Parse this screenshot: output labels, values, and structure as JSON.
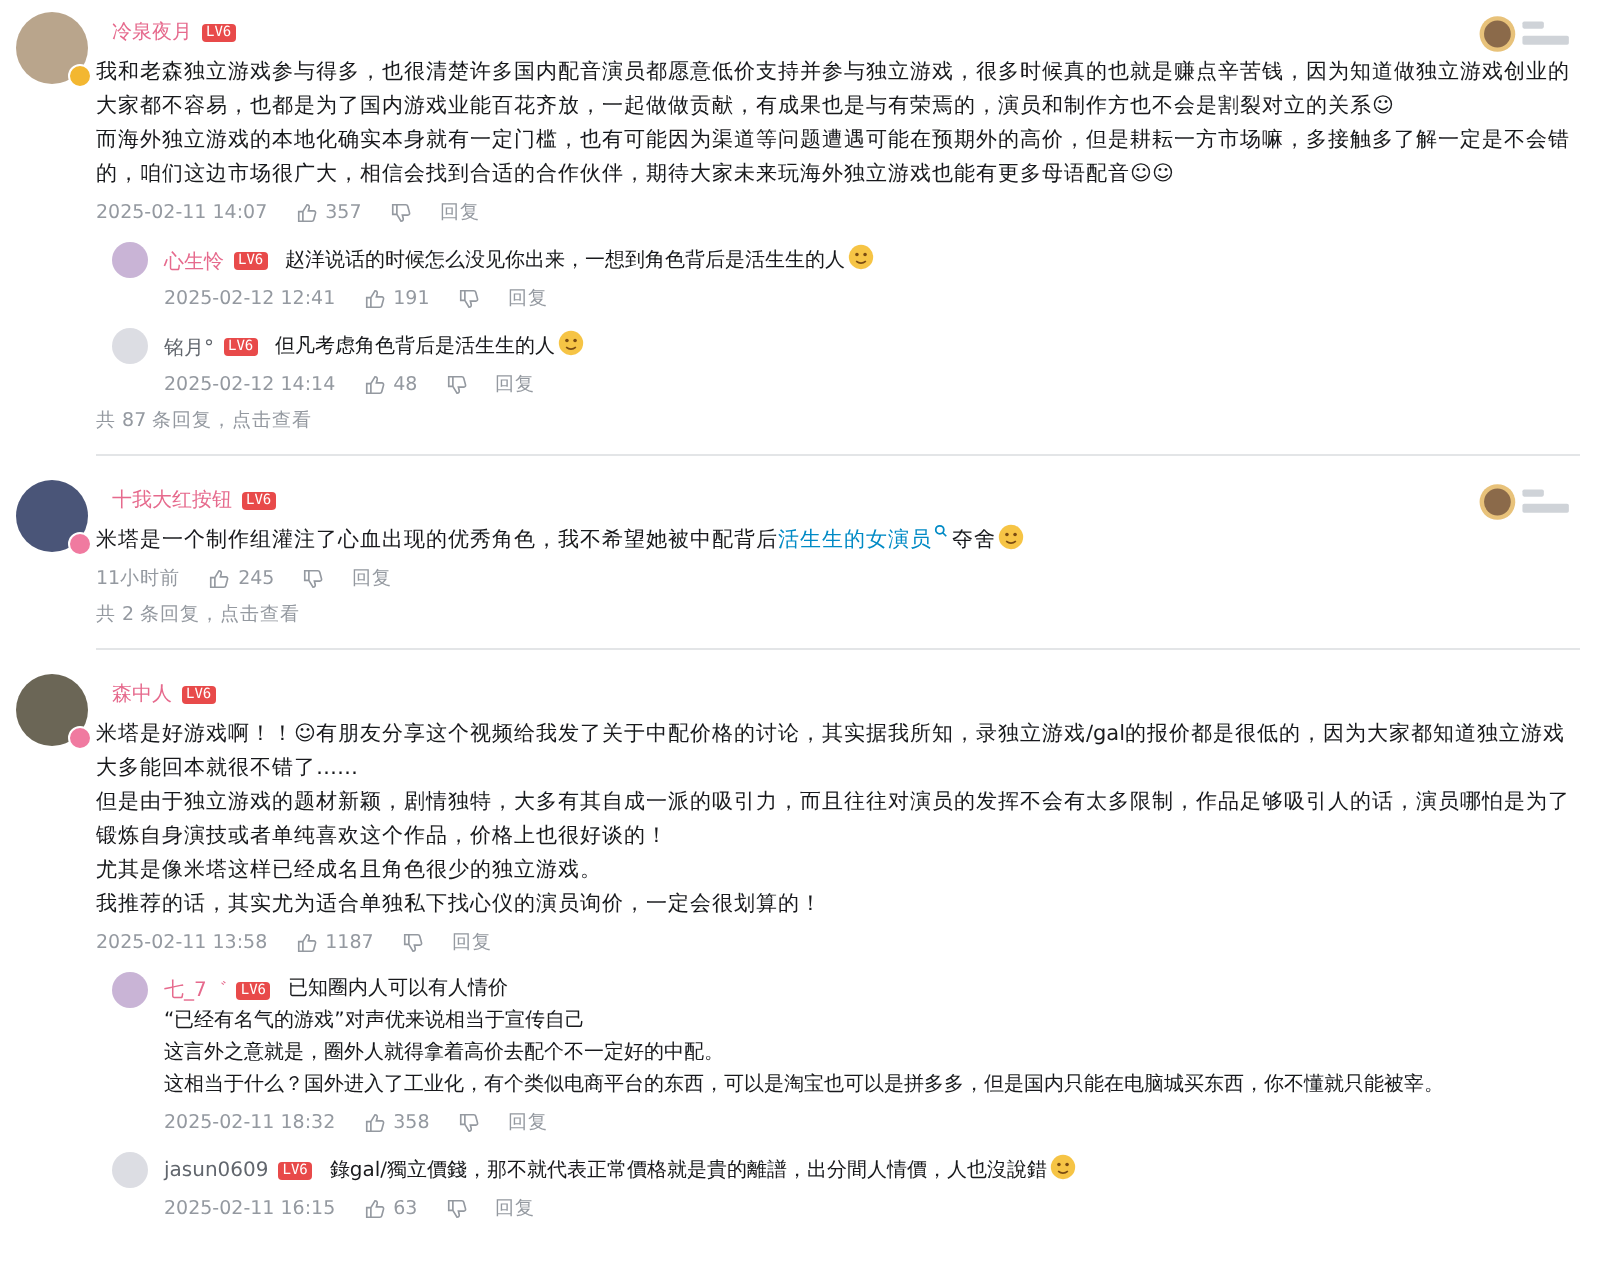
{
  "comments": [
    {
      "user": {
        "name": "冷泉夜月",
        "vip": true,
        "level": "LV6"
      },
      "avatar_badge": {
        "color": "#f3b731"
      },
      "fan_badge": true,
      "content": [
        [
          {
            "kind": "text",
            "text": "我和老森独立游戏参与得多，也很清楚许多国内配音演员都愿意低价支持并参与独立游戏，很多时候真的也就是赚点辛苦钱，因为知道做独立游戏创业的大家都不容易，也都是为了国内游戏业能百花齐放，一起做做贡献，有成果也是与有荣焉的，演员和制作方也不会是割裂对立的关系☺"
          }
        ],
        [
          {
            "kind": "text",
            "text": "而海外独立游戏的本地化确实本身就有一定门槛，也有可能因为渠道等问题遭遇可能在预期外的高价，但是耕耘一方市场嘛，多接触多了解一定是不会错的，咱们这边市场很广大，相信会找到合适的合作伙伴，期待大家未来玩海外独立游戏也能有更多母语配音☺☺"
          }
        ]
      ],
      "time": "2025-02-11 14:07",
      "likes": "357",
      "reply_label": "回复",
      "replies": [
        {
          "user": {
            "name": "心生怜",
            "vip": true,
            "level": "LV6"
          },
          "content": [
            [
              {
                "kind": "text",
                "text": "赵洋说话的时候怎么没见你出来，一想到角色背后是活生生的人"
              },
              {
                "kind": "emoji"
              }
            ]
          ],
          "time": "2025-02-12 12:41",
          "likes": "191",
          "reply_label": "回复"
        },
        {
          "user": {
            "name": "铭月°",
            "vip": false,
            "level": "LV6"
          },
          "content": [
            [
              {
                "kind": "text",
                "text": "但凡考虑角色背后是活生生的人"
              },
              {
                "kind": "emoji"
              }
            ]
          ],
          "time": "2025-02-12 14:14",
          "likes": "48",
          "reply_label": "回复"
        }
      ],
      "more_replies": "共 87 条回复，点击查看"
    },
    {
      "user": {
        "name": "十我大红按钮",
        "vip": true,
        "level": "LV6"
      },
      "avatar_badge": {
        "color": "#f07aa0"
      },
      "fan_badge": true,
      "content": [
        [
          {
            "kind": "text",
            "text": "米塔是一个制作组灌注了心血出现的优秀角色，我不希望她被中配背后"
          },
          {
            "kind": "link",
            "text": "活生生的女演员"
          },
          {
            "kind": "text",
            "text": "夺舍"
          },
          {
            "kind": "emoji"
          }
        ]
      ],
      "time": "11小时前",
      "likes": "245",
      "reply_label": "回复",
      "more_replies": "共 2 条回复，点击查看"
    },
    {
      "user": {
        "name": "森中人",
        "vip": true,
        "level": "LV6"
      },
      "avatar_badge": {
        "color": "#f07aa0"
      },
      "fan_badge": false,
      "content": [
        [
          {
            "kind": "text",
            "text": "米塔是好游戏啊！！☺有朋友分享这个视频给我发了关于中配价格的讨论，其实据我所知，录独立游戏/gal的报价都是很低的，因为大家都知道独立游戏大多能回本就很不错了……"
          }
        ],
        [
          {
            "kind": "text",
            "text": "但是由于独立游戏的题材新颖，剧情独特，大多有其自成一派的吸引力，而且往往对演员的发挥不会有太多限制，作品足够吸引人的话，演员哪怕是为了锻炼自身演技或者单纯喜欢这个作品，价格上也很好谈的！"
          }
        ],
        [
          {
            "kind": "text",
            "text": "尤其是像米塔这样已经成名且角色很少的独立游戏。"
          }
        ],
        [
          {
            "kind": "text",
            "text": "我推荐的话，其实尤为适合单独私下找心仪的演员询价，一定会很划算的！"
          }
        ]
      ],
      "time": "2025-02-11 13:58",
      "likes": "1187",
      "reply_label": "回复",
      "replies": [
        {
          "user": {
            "name": "七_7゛",
            "vip": true,
            "level": "LV6"
          },
          "content": [
            [
              {
                "kind": "text",
                "text": "已知圈内人可以有人情价"
              }
            ],
            [
              {
                "kind": "text",
                "text": "“已经有名气的游戏”对声优来说相当于宣传自己"
              }
            ],
            [
              {
                "kind": "text",
                "text": "这言外之意就是，圈外人就得拿着高价去配个不一定好的中配。"
              }
            ],
            [
              {
                "kind": "text",
                "text": "这相当于什么？国外进入了工业化，有个类似电商平台的东西，可以是淘宝也可以是拼多多，但是国内只能在电脑城买东西，你不懂就只能被宰。"
              }
            ]
          ],
          "time": "2025-02-11 18:32",
          "likes": "358",
          "reply_label": "回复"
        },
        {
          "user": {
            "name": "jasun0609",
            "vip": false,
            "level": "LV6"
          },
          "content": [
            [
              {
                "kind": "text",
                "text": "錄gal/獨立價錢，那不就代表正常價格就是貴的離譜，出分間人情價，人也沒說錯"
              },
              {
                "kind": "emoji"
              }
            ]
          ],
          "time": "2025-02-11 16:15",
          "likes": "63",
          "reply_label": "回复"
        }
      ]
    }
  ]
}
